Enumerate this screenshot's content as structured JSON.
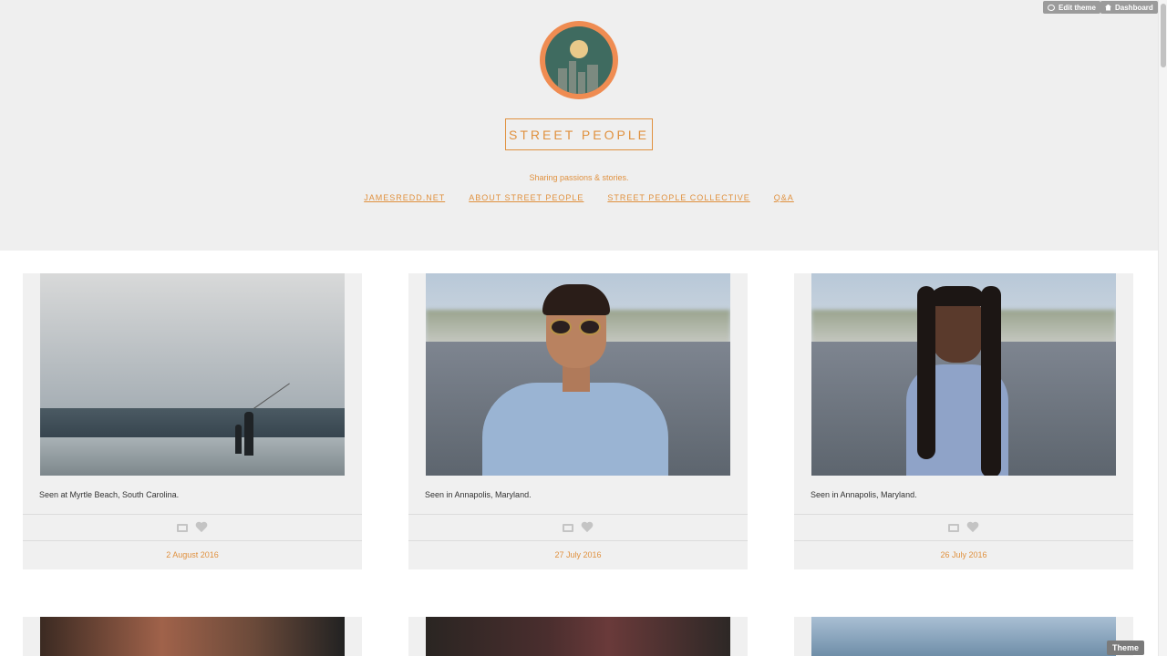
{
  "admin": {
    "edit_theme": "Edit theme",
    "dashboard": "Dashboard",
    "theme": "Theme"
  },
  "blog": {
    "title": "STREET PEOPLE",
    "tagline": "Sharing passions & stories.",
    "nav": [
      "JAMESREDD.NET",
      "ABOUT STREET PEOPLE",
      "STREET PEOPLE COLLECTIVE",
      "Q&A"
    ]
  },
  "colors": {
    "accent": "#e0913f",
    "header_bg": "#efefef",
    "card_bg": "#f0f0f0",
    "logo_ring": "#ef8c52"
  },
  "posts": [
    {
      "caption": "Seen at Myrtle Beach, South Carolina.",
      "date": "2 August 2016",
      "icons": [
        "reblog-icon",
        "heart-icon"
      ]
    },
    {
      "caption": "Seen in Annapolis, Maryland.",
      "date": "27 July 2016",
      "icons": [
        "reblog-icon",
        "heart-icon"
      ]
    },
    {
      "caption": "Seen in Annapolis, Maryland.",
      "date": "26 July 2016",
      "icons": [
        "reblog-icon",
        "heart-icon"
      ]
    }
  ]
}
